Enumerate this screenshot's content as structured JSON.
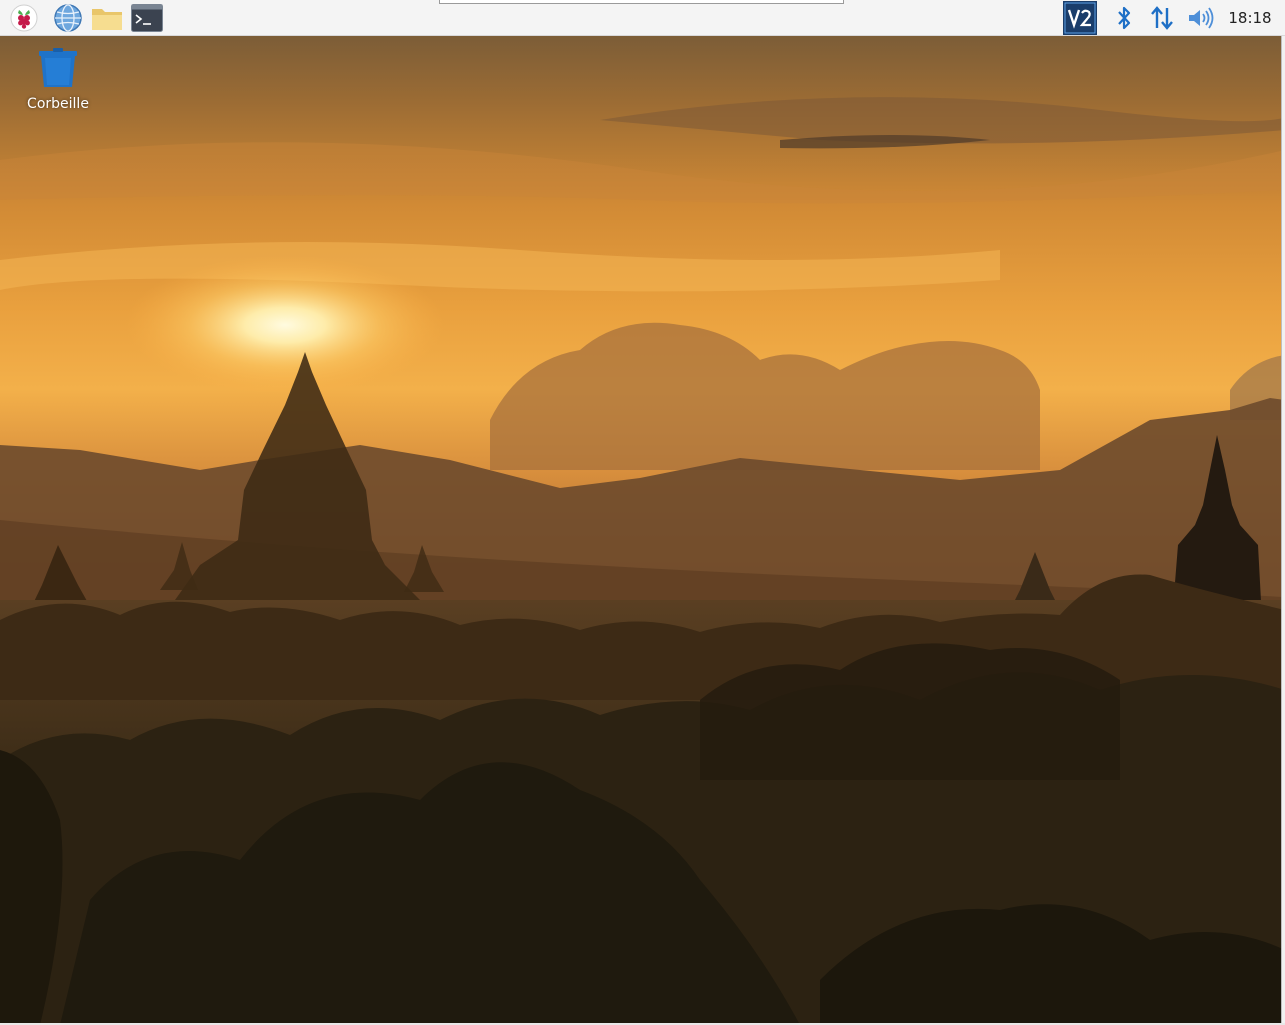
{
  "panel": {
    "launchers": [
      {
        "name": "raspberry-menu-icon"
      },
      {
        "name": "web-browser-icon"
      },
      {
        "name": "file-manager-icon"
      },
      {
        "name": "terminal-icon"
      }
    ],
    "tray": {
      "vnc_label": "V2",
      "icons": [
        "vnc-server-icon",
        "bluetooth-icon",
        "network-updown-icon",
        "volume-icon"
      ],
      "clock": "18:18"
    }
  },
  "desktop": {
    "icons": [
      {
        "label": "Corbeille",
        "icon": "trash-bin-icon"
      }
    ],
    "wallpaper": "temples-sunset-wallpaper"
  },
  "colors": {
    "panel_bg": "#f4f4f4",
    "tray_blue": "#1e6fc6",
    "vnc_bg": "#1a3d6b",
    "trash_blue": "#1f73c9"
  }
}
